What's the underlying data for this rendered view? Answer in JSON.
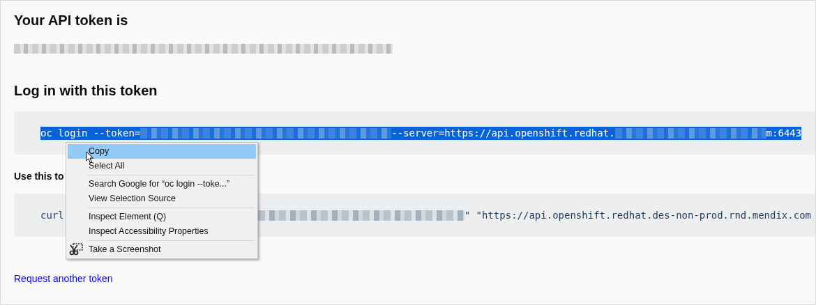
{
  "heading": "Your API token is",
  "login_heading": "Log in with this token",
  "login_code": {
    "selected": true,
    "segments": [
      {
        "kind": "text",
        "text": "oc login --token="
      },
      {
        "kind": "redacted"
      },
      {
        "kind": "text",
        "text": " --server=https://api.openshift.redhat."
      },
      {
        "kind": "redacted"
      },
      {
        "kind": "text",
        "text": "m:6443"
      }
    ]
  },
  "use_heading": "Use this to",
  "curl_code": {
    "selected": false,
    "segments": [
      {
        "kind": "text",
        "text": "curl"
      },
      {
        "kind": "redacted"
      },
      {
        "kind": "text",
        "text": "\" \"https://api.openshift.redhat.des-non-prod.rnd.mendix.com"
      }
    ]
  },
  "link": "Request another token",
  "context_menu": [
    [
      {
        "label": "Copy",
        "selected": true
      },
      {
        "label": "Select All",
        "selected": false
      }
    ],
    [
      {
        "label": "Search Google for “oc login --toke...”",
        "selected": false
      },
      {
        "label": "View Selection Source",
        "selected": false
      }
    ],
    [
      {
        "label": "Inspect Element (Q)",
        "selected": false
      },
      {
        "label": "Inspect Accessibility Properties",
        "selected": false
      }
    ],
    [
      {
        "label": "Take a Screenshot",
        "selected": false,
        "kind": "screenshot"
      }
    ]
  ]
}
